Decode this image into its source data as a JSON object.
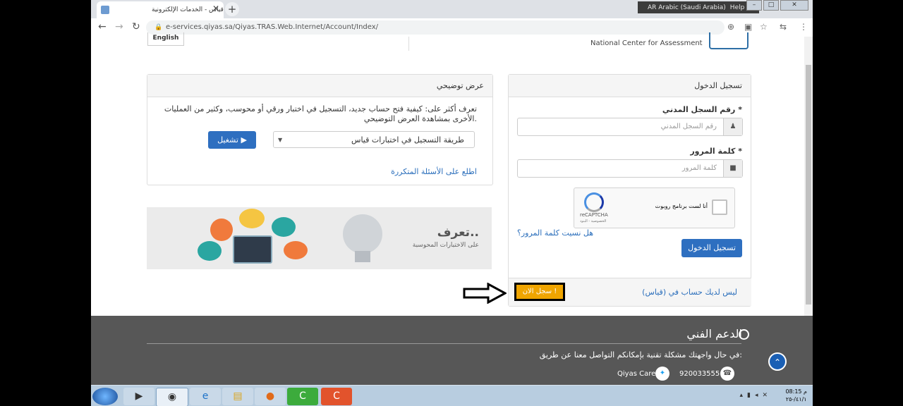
{
  "browser": {
    "tab_title": "قياس - الخدمات الإلكترونية",
    "tab_close": "✕",
    "new_tab": "+",
    "url": "e-services.qiyas.sa/Qiyas.TRAS.Web.Internet/Account/Index/",
    "language": "AR Arabic (Saudi Arabia)",
    "help": "Help"
  },
  "header": {
    "english_link": "English",
    "org_name": "National Center for Assessment"
  },
  "login": {
    "title": "تسجيل الدخول",
    "id_label": "رقم السجل المدني *",
    "id_placeholder": "رقم السجل المدني",
    "password_label": "كلمة المرور *",
    "password_placeholder": "كلمة المرور",
    "captcha_text": "أنا لست برنامج روبوت",
    "captcha_brand": "reCAPTCHA",
    "captcha_sub": "الخصوصية - البنود",
    "forgot": "هل نسيت كلمة المرور؟",
    "submit": "تسجيل الدخول",
    "no_account": "ليس لديك حساب في (قياس)",
    "register": "سجل الان !"
  },
  "demo": {
    "title": "عرض توضيحي",
    "description": "تعرف أكثر على: كيفية فتح حساب جديد، التسجيل في اختبار ورقي أو محوسب، وكثير من العمليات الأخرى بمشاهدة العرض التوضيحي.",
    "select_value": "طريقة التسجيل في اختبارات قياس",
    "play_button": "تشغيل",
    "faq": "اطلع على الأسئلة المتكررة"
  },
  "banner": {
    "headline": "تعرف..",
    "subline": "على الاختبارات المحوسبة"
  },
  "footer": {
    "title": "الدعم الفني",
    "description": "في حال واجهتك مشكلة تقنية بإمكانكم التواصل معنا عن طريق:",
    "phone": "920033555",
    "twitter": "Qiyas Care"
  },
  "taskbar": {
    "time": "08:15 م",
    "date": "٤١/١/-٢٥"
  },
  "colors": {
    "primary_button": "#2e6fc0",
    "register_button": "#f0a500",
    "footer_bg": "#575757"
  }
}
